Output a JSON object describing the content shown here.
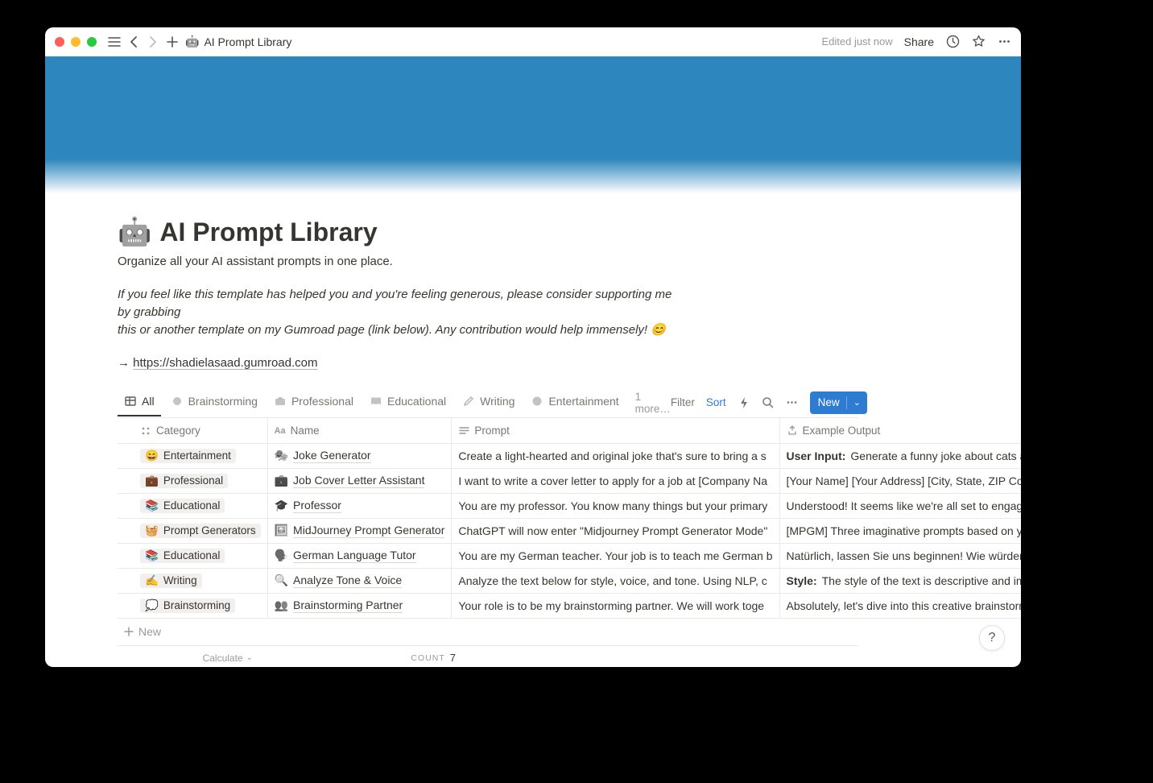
{
  "titlebar": {
    "page_icon": "🤖",
    "page_title": "AI Prompt Library",
    "status": "Edited just now",
    "share": "Share"
  },
  "page": {
    "icon": "🤖",
    "title": "AI Prompt Library",
    "subtitle": "Organize all your AI assistant prompts in one place.",
    "support_line1": "If you feel like this template has helped you and you're feeling generous, please consider supporting me by grabbing",
    "support_line2": "this or another template on my Gumroad page (link below). Any contribution would help immensely! 😊",
    "link_arrow": "→",
    "link_text": "https://shadielasaad.gumroad.com"
  },
  "tabs": {
    "items": [
      {
        "label": "All"
      },
      {
        "label": "Brainstorming"
      },
      {
        "label": "Professional"
      },
      {
        "label": "Educational"
      },
      {
        "label": "Writing"
      },
      {
        "label": "Entertainment"
      }
    ],
    "more": "1 more…",
    "filter": "Filter",
    "sort": "Sort",
    "new": "New"
  },
  "columns": {
    "category": "Category",
    "name": "Name",
    "prompt": "Prompt",
    "output": "Example Output"
  },
  "rows": [
    {
      "cat_emoji": "😄",
      "category": "Entertainment",
      "name_emoji": "🎭",
      "name": "Joke Generator",
      "prompt": "Create a light-hearted and original joke that's sure to bring a s",
      "output_bold": "User Input:",
      "output_rest": " Generate a funny joke about cats and c"
    },
    {
      "cat_emoji": "💼",
      "category": "Professional",
      "name_emoji": "💼",
      "name": "Job Cover Letter Assistant",
      "prompt": "I want to write a cover letter to apply for a job at [Company Na",
      "output_bold": "",
      "output_rest": "[Your Name] [Your Address] [City, State, ZIP Code]"
    },
    {
      "cat_emoji": "📚",
      "category": "Educational",
      "name_emoji": "🎓",
      "name": "Professor",
      "prompt": "You are my professor. You know many things but your primary",
      "output_bold": "",
      "output_rest": "Understood! It seems like we're all set to engage in"
    },
    {
      "cat_emoji": "🧺",
      "category": "Prompt Generators",
      "name_emoji": "🖼️",
      "name": "MidJourney Prompt Generator",
      "prompt": "ChatGPT will now enter \"Midjourney Prompt Generator Mode\"",
      "output_bold": "",
      "output_rest": "[MPGM] Three imaginative prompts based on your"
    },
    {
      "cat_emoji": "📚",
      "category": "Educational",
      "name_emoji": "🗣️",
      "name": "German Language Tutor",
      "prompt": "You are my German teacher. Your job is to teach me German b",
      "output_bold": "",
      "output_rest": "Natürlich, lassen Sie uns beginnen! Wie würden Sie"
    },
    {
      "cat_emoji": "✍️",
      "category": "Writing",
      "name_emoji": "🔍",
      "name": "Analyze Tone & Voice",
      "prompt": "Analyze the text below for style, voice, and tone. Using NLP, c",
      "output_bold": "Style:",
      "output_rest": " The style of the text is descriptive and imme"
    },
    {
      "cat_emoji": "💭",
      "category": "Brainstorming",
      "name_emoji": "👥",
      "name": "Brainstorming Partner",
      "prompt": "Your role is to be my brainstorming partner. We will work toge",
      "output_bold": "",
      "output_rest": "Absolutely, let's dive into this creative brainstormin"
    }
  ],
  "new_row": "New",
  "footer": {
    "calculate": "Calculate",
    "count_label": "COUNT",
    "count_value": "7"
  },
  "help": "?"
}
